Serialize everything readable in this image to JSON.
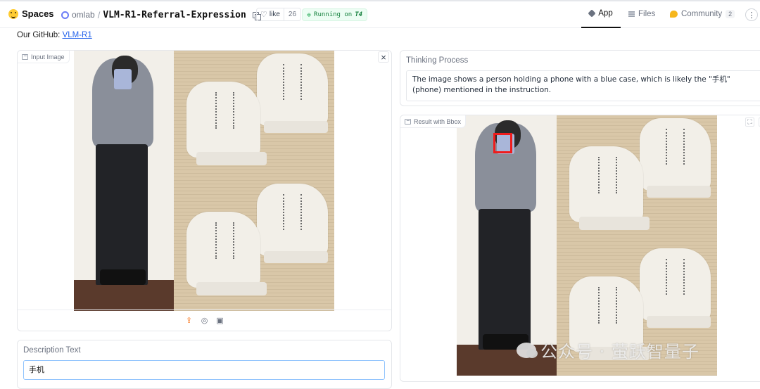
{
  "header": {
    "brand": "Spaces",
    "org": "omlab",
    "separator": "/",
    "repo": "VLM-R1-Referral-Expression",
    "like_label": "like",
    "like_count": "26",
    "status_prefix": "Running on",
    "status_hardware": "T4",
    "nav": {
      "app": "App",
      "files": "Files",
      "community": "Community",
      "community_count": "2"
    },
    "menu_glyph": "⋮"
  },
  "github": {
    "prefix": "Our GitHub:",
    "link_text": "VLM-R1"
  },
  "input_image": {
    "label": "Input Image",
    "close_glyph": "×"
  },
  "description": {
    "label": "Description Text",
    "value": "手机"
  },
  "thinking": {
    "label": "Thinking Process",
    "text": "The image shows a person holding a phone with a blue case, which is likely the \"手机\" (phone) mentioned in the instruction."
  },
  "result": {
    "label": "Result with Bbox"
  },
  "watermark": {
    "text": "公众号 · 萤跃智量子"
  },
  "icons": {
    "upload": "upload-icon",
    "webcam": "webcam-icon",
    "clipboard": "clipboard-icon",
    "fullscreen": "fullscreen-icon",
    "download": "download-icon"
  }
}
